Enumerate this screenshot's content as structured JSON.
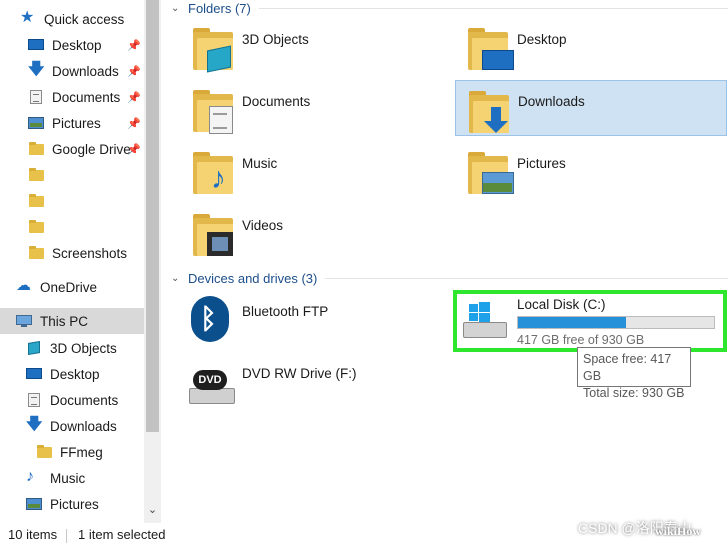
{
  "sidebar": {
    "items": [
      {
        "label": "Quick access",
        "icon": "star-icon",
        "pinned": false
      },
      {
        "label": "Desktop",
        "icon": "desktop-icon",
        "pinned": true
      },
      {
        "label": "Downloads",
        "icon": "download-arrow-icon",
        "pinned": true
      },
      {
        "label": "Documents",
        "icon": "documents-icon",
        "pinned": true
      },
      {
        "label": "Pictures",
        "icon": "pictures-icon",
        "pinned": true
      },
      {
        "label": "Google Drive",
        "icon": "folder-icon",
        "pinned": true
      },
      {
        "label": "",
        "icon": "folder-icon",
        "pinned": false
      },
      {
        "label": "",
        "icon": "folder-icon",
        "pinned": false
      },
      {
        "label": "",
        "icon": "folder-icon",
        "pinned": false
      },
      {
        "label": "Screenshots",
        "icon": "folder-icon",
        "pinned": false
      },
      {
        "label": "OneDrive",
        "icon": "cloud-icon",
        "pinned": false
      },
      {
        "label": "This PC",
        "icon": "computer-icon",
        "pinned": false,
        "selected": true
      },
      {
        "label": "3D Objects",
        "icon": "3d-objects-icon",
        "pinned": false
      },
      {
        "label": "Desktop",
        "icon": "desktop-icon",
        "pinned": false
      },
      {
        "label": "Documents",
        "icon": "documents-icon",
        "pinned": false
      },
      {
        "label": "Downloads",
        "icon": "download-arrow-icon",
        "pinned": false
      },
      {
        "label": "FFmeg",
        "icon": "folder-icon",
        "pinned": false
      },
      {
        "label": "Music",
        "icon": "music-note-icon",
        "pinned": false
      },
      {
        "label": "Pictures",
        "icon": "pictures-icon",
        "pinned": false
      }
    ]
  },
  "groups": {
    "folders_header": "Folders (7)",
    "devices_header": "Devices and drives (3)"
  },
  "folders": [
    {
      "label": "3D Objects",
      "icon": "3d-objects-folder-icon"
    },
    {
      "label": "Desktop",
      "icon": "desktop-folder-icon"
    },
    {
      "label": "Documents",
      "icon": "documents-folder-icon"
    },
    {
      "label": "Downloads",
      "icon": "downloads-folder-icon",
      "selected": true
    },
    {
      "label": "Music",
      "icon": "music-folder-icon"
    },
    {
      "label": "Pictures",
      "icon": "pictures-folder-icon"
    },
    {
      "label": "Videos",
      "icon": "videos-folder-icon"
    }
  ],
  "devices": {
    "bluetooth": {
      "label": "Bluetooth FTP",
      "icon": "bluetooth-icon"
    },
    "dvd": {
      "label": "DVD RW Drive (F:)",
      "icon": "dvd-drive-icon",
      "badge": "DVD"
    },
    "local_disk": {
      "label": "Local Disk (C:)",
      "free_text": "417 GB free of 930 GB",
      "used_fraction": 0.552,
      "icon": "windows-drive-icon"
    }
  },
  "tooltip": {
    "space_free": "Space free: 417 GB",
    "total_size": "Total size: 930 GB"
  },
  "statusbar": {
    "item_count": "10 items",
    "selection": "1 item selected"
  },
  "watermark": {
    "csdn": "CSDN @洛阳泰山",
    "wikihow": "wikiHow"
  },
  "colors": {
    "highlight_border": "#2ee62e",
    "progress_fill": "#2691d9",
    "selection_bg": "#cfe2f3",
    "group_header": "#1c4e8a"
  }
}
